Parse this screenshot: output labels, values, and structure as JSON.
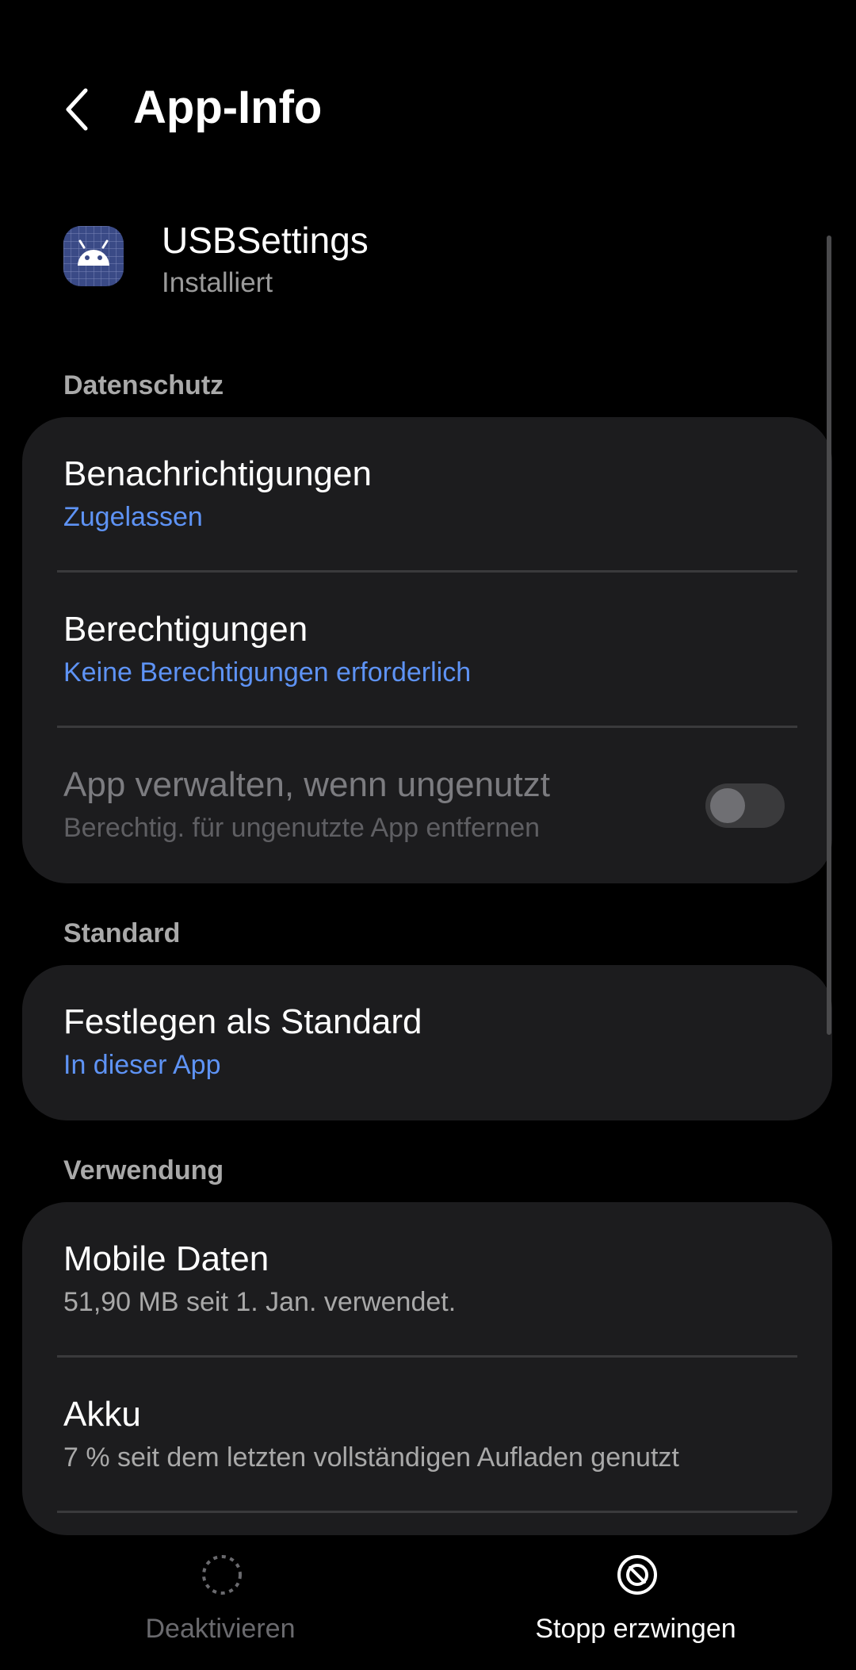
{
  "header": {
    "title": "App-Info",
    "back_icon": "back-arrow-icon"
  },
  "app": {
    "name": "USBSettings",
    "status": "Installiert",
    "icon": "android-icon"
  },
  "sections": {
    "privacy": "Datenschutz",
    "default": "Standard",
    "usage": "Verwendung"
  },
  "privacy_items": {
    "notifications": {
      "title": "Benachrichtigungen",
      "sub": "Zugelassen"
    },
    "permissions": {
      "title": "Berechtigungen",
      "sub": "Keine Berechtigungen erforderlich"
    },
    "manage_unused": {
      "title": "App verwalten, wenn ungenutzt",
      "sub": "Berechtig. für ungenutzte App entfernen",
      "toggle_on": false
    }
  },
  "default_items": {
    "set_default": {
      "title": "Festlegen als Standard",
      "sub": "In dieser App"
    }
  },
  "usage_items": {
    "mobile_data": {
      "title": "Mobile Daten",
      "sub": "51,90 MB seit 1. Jan. verwendet."
    },
    "battery": {
      "title": "Akku",
      "sub": "7 % seit dem letzten vollständigen Aufladen genutzt"
    }
  },
  "bottom": {
    "disable": {
      "label": "Deaktivieren",
      "icon": "dashed-circle-icon"
    },
    "force_stop": {
      "label": "Stopp erzwingen",
      "icon": "stop-circle-icon"
    }
  },
  "colors": {
    "background": "#000000",
    "card": "#1c1c1e",
    "accent": "#5e93f5",
    "secondary_text": "#a9a9a9"
  }
}
